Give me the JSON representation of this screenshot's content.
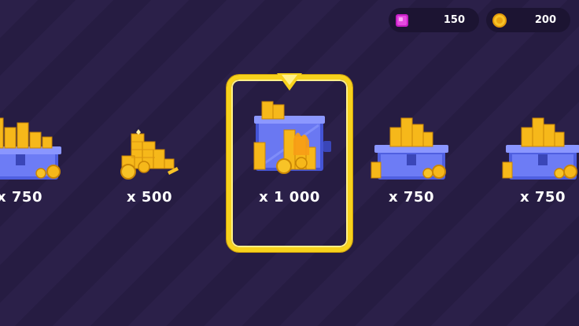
{
  "currency": {
    "gems": {
      "icon": "gem-icon",
      "value": "150",
      "color": "#e02fd6"
    },
    "coins": {
      "icon": "coin-icon",
      "value": "200",
      "color": "#f6b81a"
    }
  },
  "offers": [
    {
      "label": "x 750",
      "art": "coin-chest-icon",
      "selected": false
    },
    {
      "label": "x 500",
      "art": "coin-pile-icon",
      "selected": false
    },
    {
      "label": "x 1 000",
      "art": "coin-crate-icon",
      "selected": true
    },
    {
      "label": "x 750",
      "art": "coin-chest-icon",
      "selected": false
    },
    {
      "label": "x 750",
      "art": "coin-chest-icon",
      "selected": false
    }
  ],
  "colors": {
    "background": "#2a1f47",
    "frame": "#f7d21c",
    "chest": "#5a6df0",
    "coin": "#f6b81a"
  }
}
